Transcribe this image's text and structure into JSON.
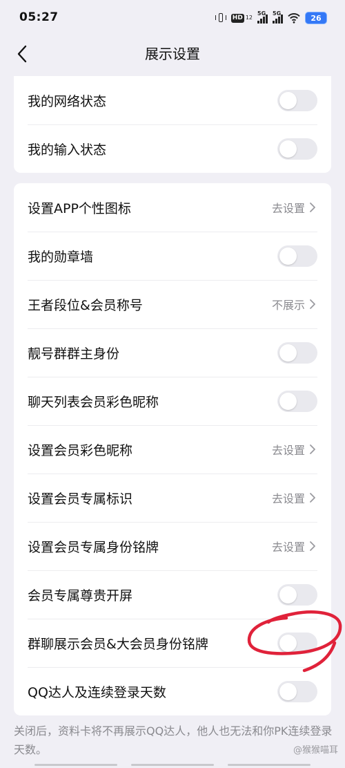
{
  "status_bar": {
    "time": "05:27",
    "hd_label": "HD",
    "hd_sup": "12",
    "signal_1_label": "5G",
    "signal_2_label": "5G",
    "battery": "26",
    "icons": [
      "vibrate-icon",
      "hd-icon",
      "signal-icon",
      "signal-icon",
      "wifi-icon",
      "battery-icon"
    ]
  },
  "nav": {
    "title": "展示设置",
    "back_icon": "chevron-left-icon"
  },
  "section1": {
    "rows": [
      {
        "label": "我的网络状态",
        "type": "toggle",
        "on": false
      },
      {
        "label": "我的输入状态",
        "type": "toggle",
        "on": false
      }
    ]
  },
  "section2": {
    "rows": [
      {
        "label": "设置APP个性图标",
        "type": "nav",
        "value": "去设置"
      },
      {
        "label": "我的勋章墙",
        "type": "toggle",
        "on": false
      },
      {
        "label": "王者段位&会员称号",
        "type": "nav",
        "value": "不展示"
      },
      {
        "label": "靓号群群主身份",
        "type": "toggle",
        "on": false
      },
      {
        "label": "聊天列表会员彩色昵称",
        "type": "toggle",
        "on": false
      },
      {
        "label": "设置会员彩色昵称",
        "type": "nav",
        "value": "去设置"
      },
      {
        "label": "设置会员专属标识",
        "type": "nav",
        "value": "去设置"
      },
      {
        "label": "设置会员专属身份铭牌",
        "type": "nav",
        "value": "去设置"
      },
      {
        "label": "会员专属尊贵开屏",
        "type": "toggle",
        "on": false
      },
      {
        "label": "群聊展示会员&大会员身份铭牌",
        "type": "toggle",
        "on": false
      },
      {
        "label": "QQ达人及连续登录天数",
        "type": "toggle",
        "on": false
      }
    ]
  },
  "footer": {
    "note": "关闭后，资料卡将不再展示QQ达人，他人也无法和你PK连续登录天数。",
    "watermark": "@猴猴喵耳"
  },
  "colors": {
    "background": "#f0eff5",
    "card": "#ffffff",
    "toggle_off": "#e9e9ee",
    "secondary_text": "#8a8a8f",
    "battery": "#3478f6",
    "marker": "#e0223a"
  }
}
